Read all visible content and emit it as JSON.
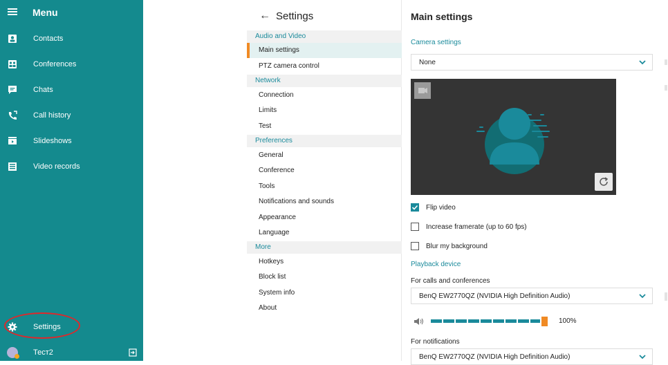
{
  "menu": {
    "title": "Menu",
    "items": [
      {
        "label": "Contacts",
        "icon": "contacts-icon"
      },
      {
        "label": "Conferences",
        "icon": "conferences-icon"
      },
      {
        "label": "Chats",
        "icon": "chats-icon"
      },
      {
        "label": "Call history",
        "icon": "call-history-icon"
      },
      {
        "label": "Slideshows",
        "icon": "slideshows-icon"
      },
      {
        "label": "Video records",
        "icon": "video-records-icon"
      }
    ],
    "settings_label": "Settings",
    "user_name": "Тест2",
    "colors": {
      "background": "#148a8e",
      "highlight_circle": "#e0272a"
    }
  },
  "nav": {
    "title": "Settings",
    "sections": [
      {
        "label": "Audio and Video",
        "items": [
          "Main settings",
          "PTZ camera control"
        ]
      },
      {
        "label": "Network",
        "items": [
          "Connection",
          "Limits",
          "Test"
        ]
      },
      {
        "label": "Preferences",
        "items": [
          "General",
          "Conference",
          "Tools",
          "Notifications and sounds",
          "Appearance",
          "Language"
        ]
      },
      {
        "label": "More",
        "items": [
          "Hotkeys",
          "Block list",
          "System info",
          "About"
        ]
      }
    ],
    "active_item": "Main settings",
    "accent_color": "#f08a24"
  },
  "main": {
    "title": "Main settings",
    "camera_settings_label": "Camera settings",
    "camera_select": "None",
    "checkboxes": [
      {
        "label": "Flip video",
        "checked": true
      },
      {
        "label": "Increase framerate (up to 60 fps)",
        "checked": false
      },
      {
        "label": "Blur my background",
        "checked": false
      }
    ],
    "playback_device_label": "Playback device",
    "calls_label": "For calls and conferences",
    "calls_device": "BenQ EW2770QZ (NVIDIA High Definition Audio)",
    "volume_percent": "100%",
    "volume_level": 1.0,
    "notifications_label": "For notifications",
    "notifications_device": "BenQ EW2770QZ (NVIDIA High Definition Audio)",
    "accent_color": "#1a8a9b"
  }
}
